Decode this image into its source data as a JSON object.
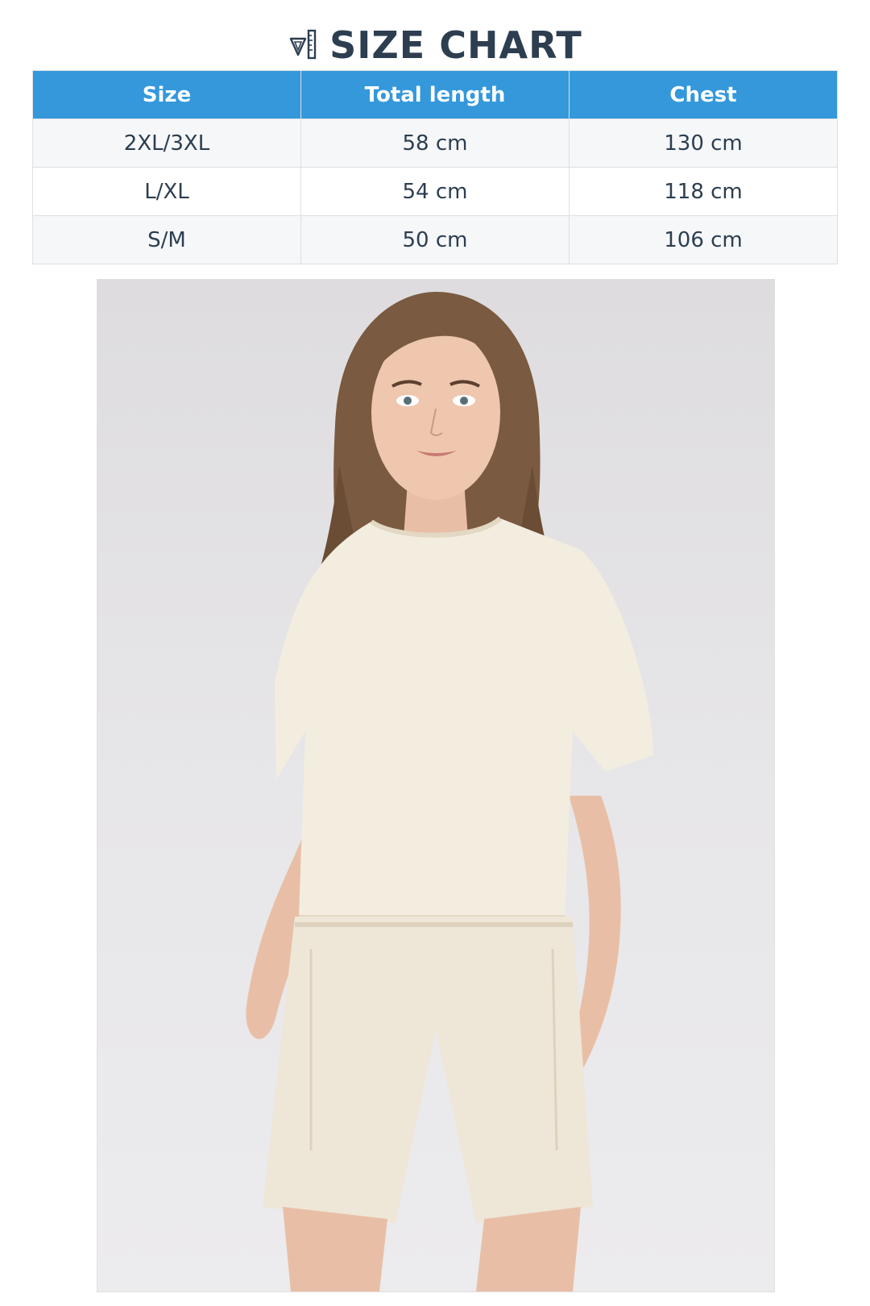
{
  "header": {
    "icon": "ruler-triangle-icon",
    "title": "SIZE CHART"
  },
  "size_table": {
    "header_color": "#3498db",
    "columns": [
      "Size",
      "Total length",
      "Chest"
    ],
    "rows": [
      [
        "2XL/3XL",
        "58 cm",
        "130 cm"
      ],
      [
        "L/XL",
        "54 cm",
        "118 cm"
      ],
      [
        "S/M",
        "50 cm",
        "106 cm"
      ]
    ]
  },
  "photo": {
    "subject": "model-photo"
  }
}
